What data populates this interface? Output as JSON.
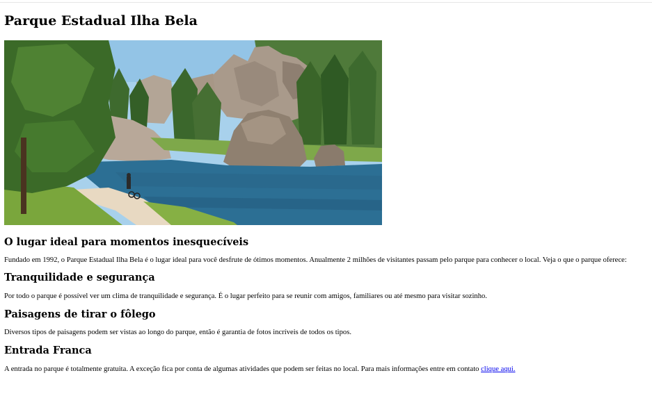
{
  "page": {
    "title": "Parque Estadual Ilha Bela",
    "hero_image": "lake-with-rocks-and-trees-photo"
  },
  "sections": [
    {
      "heading": "O lugar ideal para momentos inesquecíveis",
      "text": "Fundado em 1992, o Parque Estadual Ilha Bela é o lugar ideal para você desfrute de ótimos momentos. Anualmente 2 milhões de visitantes passam pelo parque para conhecer o local. Veja o que o parque oferece:"
    },
    {
      "heading": "Tranquilidade e segurança",
      "text": "Por todo o parque é possível ver um clima de tranquilidade e segurança. É o lugar perfeito para se reunir com amigos, familiares ou até mesmo para visitar sozinho."
    },
    {
      "heading": "Paisagens de tirar o fôlego",
      "text": "Diversos tipos de paisagens podem ser vistas ao longo do parque, então é garantia de fotos incríveis de todos os tipos."
    },
    {
      "heading": "Entrada Franca",
      "text": "A entrada no parque é totalmente gratuita. A exceção fica por conta de algumas atividades que podem ser feitas no local. Para mais informações entre em contato ",
      "link_text": "clique aqui."
    }
  ],
  "colors": {
    "link": "#0000ee",
    "sky": "#9cc9e6",
    "water": "#2a6f93",
    "rock": "#9a8a7c",
    "tree": "#3d6b2f",
    "grass": "#7fae3e"
  }
}
